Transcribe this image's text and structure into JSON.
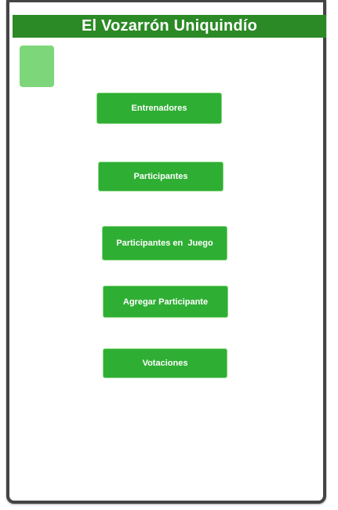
{
  "header": {
    "title": "El Vozarrón Uniquindío"
  },
  "menu": {
    "entrenadores": "Entrenadores",
    "participantes": "Participantes",
    "participantes_en_juego": "Participantes en  Juego",
    "agregar_participante": "Agregar Participante",
    "votaciones": "Votaciones"
  },
  "colors": {
    "header_bg": "#2b8a25",
    "button_bg": "#2fae34",
    "logo_bg": "#7ed67a",
    "frame_border": "#444444"
  }
}
